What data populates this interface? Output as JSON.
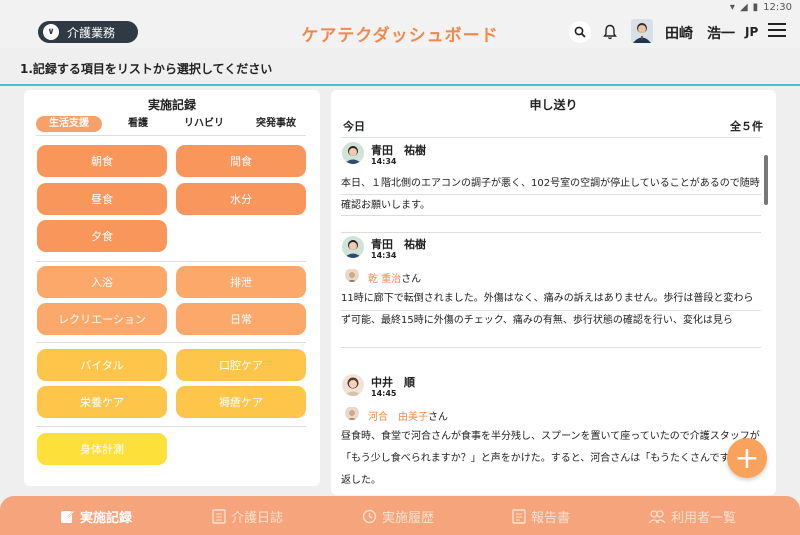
{
  "status_bar": {
    "time": "12:30"
  },
  "header": {
    "department": "介護業務",
    "title": "ケアテクダッシュボード",
    "user_name": "田崎　浩一",
    "language": "JP"
  },
  "instruction": "1.記録する項目をリストから選択してください",
  "records_panel": {
    "title": "実施記録",
    "tabs": [
      "生活支援",
      "看護",
      "リハビリ",
      "突発事故"
    ],
    "active_tab": 0,
    "buttons": [
      "朝食",
      "間食",
      "昼食",
      "水分",
      "夕食",
      "入浴",
      "排泄",
      "レクリエーション",
      "日常",
      "バイタル",
      "口腔ケア",
      "栄養ケア",
      "褥瘡ケア",
      "身体計測"
    ]
  },
  "handover_panel": {
    "title": "申し送り",
    "today_label": "今日",
    "count_label": "全５件",
    "entries": [
      {
        "author": "青田　祐樹",
        "time": "14:34",
        "text": "本日、１階北側のエアコンの調子が悪く、102号室の空調が停止していることがあるので随時確認お願いします。"
      },
      {
        "author": "青田　祐樹",
        "time": "14:34",
        "resident": "乾 重治",
        "resident_suffix": "さん",
        "text": "11時に廊下で転倒されました。外傷はなく、痛みの訴えはありません。歩行は普段と変わらず可能、最終15時に外傷のチェック、痛みの有無、歩行状態の確認を行い、変化は見ら"
      },
      {
        "author": "中井　順",
        "time": "14:45",
        "resident": "河合　由美子",
        "resident_suffix": "さん",
        "text": "昼食時、食堂で河合さんが食事を半分残し、スプーンを置いて座っていたので介護スタッフが「もう少し食べられますか？」と声をかけた。すると、河合さんは「もうたくさんですよ」と返した。"
      }
    ]
  },
  "bottom_nav": {
    "items": [
      "実施記録",
      "介護日誌",
      "実施履歴",
      "報告書",
      "利用者一覧"
    ],
    "active": 0
  },
  "colors": {
    "accent": "#f08a4b",
    "divider": "#3bc5d2",
    "nav_bg": "#f5a47b",
    "button_orange": "#f9965c",
    "button_yellow": "#fdc64a"
  }
}
